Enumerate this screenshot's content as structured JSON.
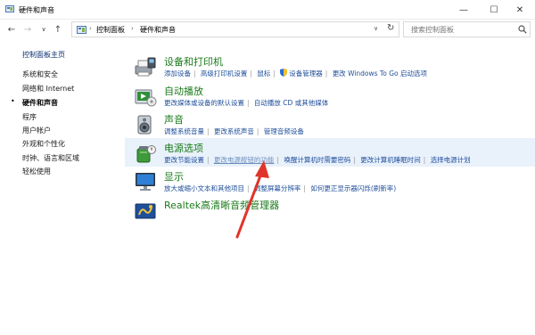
{
  "window": {
    "title": "硬件和声音",
    "minimize": "—",
    "maximize": "☐",
    "close": "✕"
  },
  "nav": {
    "back": "←",
    "forward": "→",
    "recent": "∨",
    "up": "↑",
    "breadcrumb": [
      "控制面板",
      "硬件和声音"
    ],
    "separator": "›",
    "dropdown": "∨",
    "refresh": "↻",
    "search_placeholder": "搜索控制面板"
  },
  "sidebar": {
    "home": "控制面板主页",
    "items": [
      {
        "label": "系统和安全",
        "current": false
      },
      {
        "label": "网络和 Internet",
        "current": false
      },
      {
        "label": "硬件和声音",
        "current": true
      },
      {
        "label": "程序",
        "current": false
      },
      {
        "label": "用户帐户",
        "current": false
      },
      {
        "label": "外观和个性化",
        "current": false
      },
      {
        "label": "时钟、语言和区域",
        "current": false
      },
      {
        "label": "轻松使用",
        "current": false
      }
    ],
    "bullet": "•"
  },
  "categories": [
    {
      "title": "设备和打印机",
      "icon": "printer-icon",
      "links": [
        "添加设备",
        "高级打印机设置",
        "鼠标",
        "设备管理器",
        "更改 Windows To Go 启动选项"
      ]
    },
    {
      "title": "自动播放",
      "icon": "autoplay-icon",
      "links": [
        "更改媒体或设备的默认设置",
        "自动播放 CD 或其他媒体"
      ]
    },
    {
      "title": "声音",
      "icon": "speaker-icon",
      "links": [
        "调整系统音量",
        "更改系统声音",
        "管理音频设备"
      ]
    },
    {
      "title": "电源选项",
      "icon": "power-options-icon",
      "highlighted": true,
      "links": [
        "更改节能设置",
        "更改电源按钮的功能",
        "唤醒计算机时需要密码",
        "更改计算机睡眠时间",
        "选择电源计划"
      ]
    },
    {
      "title": "显示",
      "icon": "monitor-icon",
      "links": [
        "放大或缩小文本和其他项目",
        "调整屏幕分辨率",
        "如何更正显示器闪烁(刷新率)"
      ]
    },
    {
      "title": "Realtek高清晰音频管理器",
      "icon": "realtek-audio-icon",
      "links": []
    }
  ],
  "colors": {
    "category_title": "#1a7a1a",
    "link": "#1f4e9a",
    "visited_link": "#6d8fbd",
    "highlight": "#e9f1fb",
    "annotation_arrow": "#e0342a"
  }
}
